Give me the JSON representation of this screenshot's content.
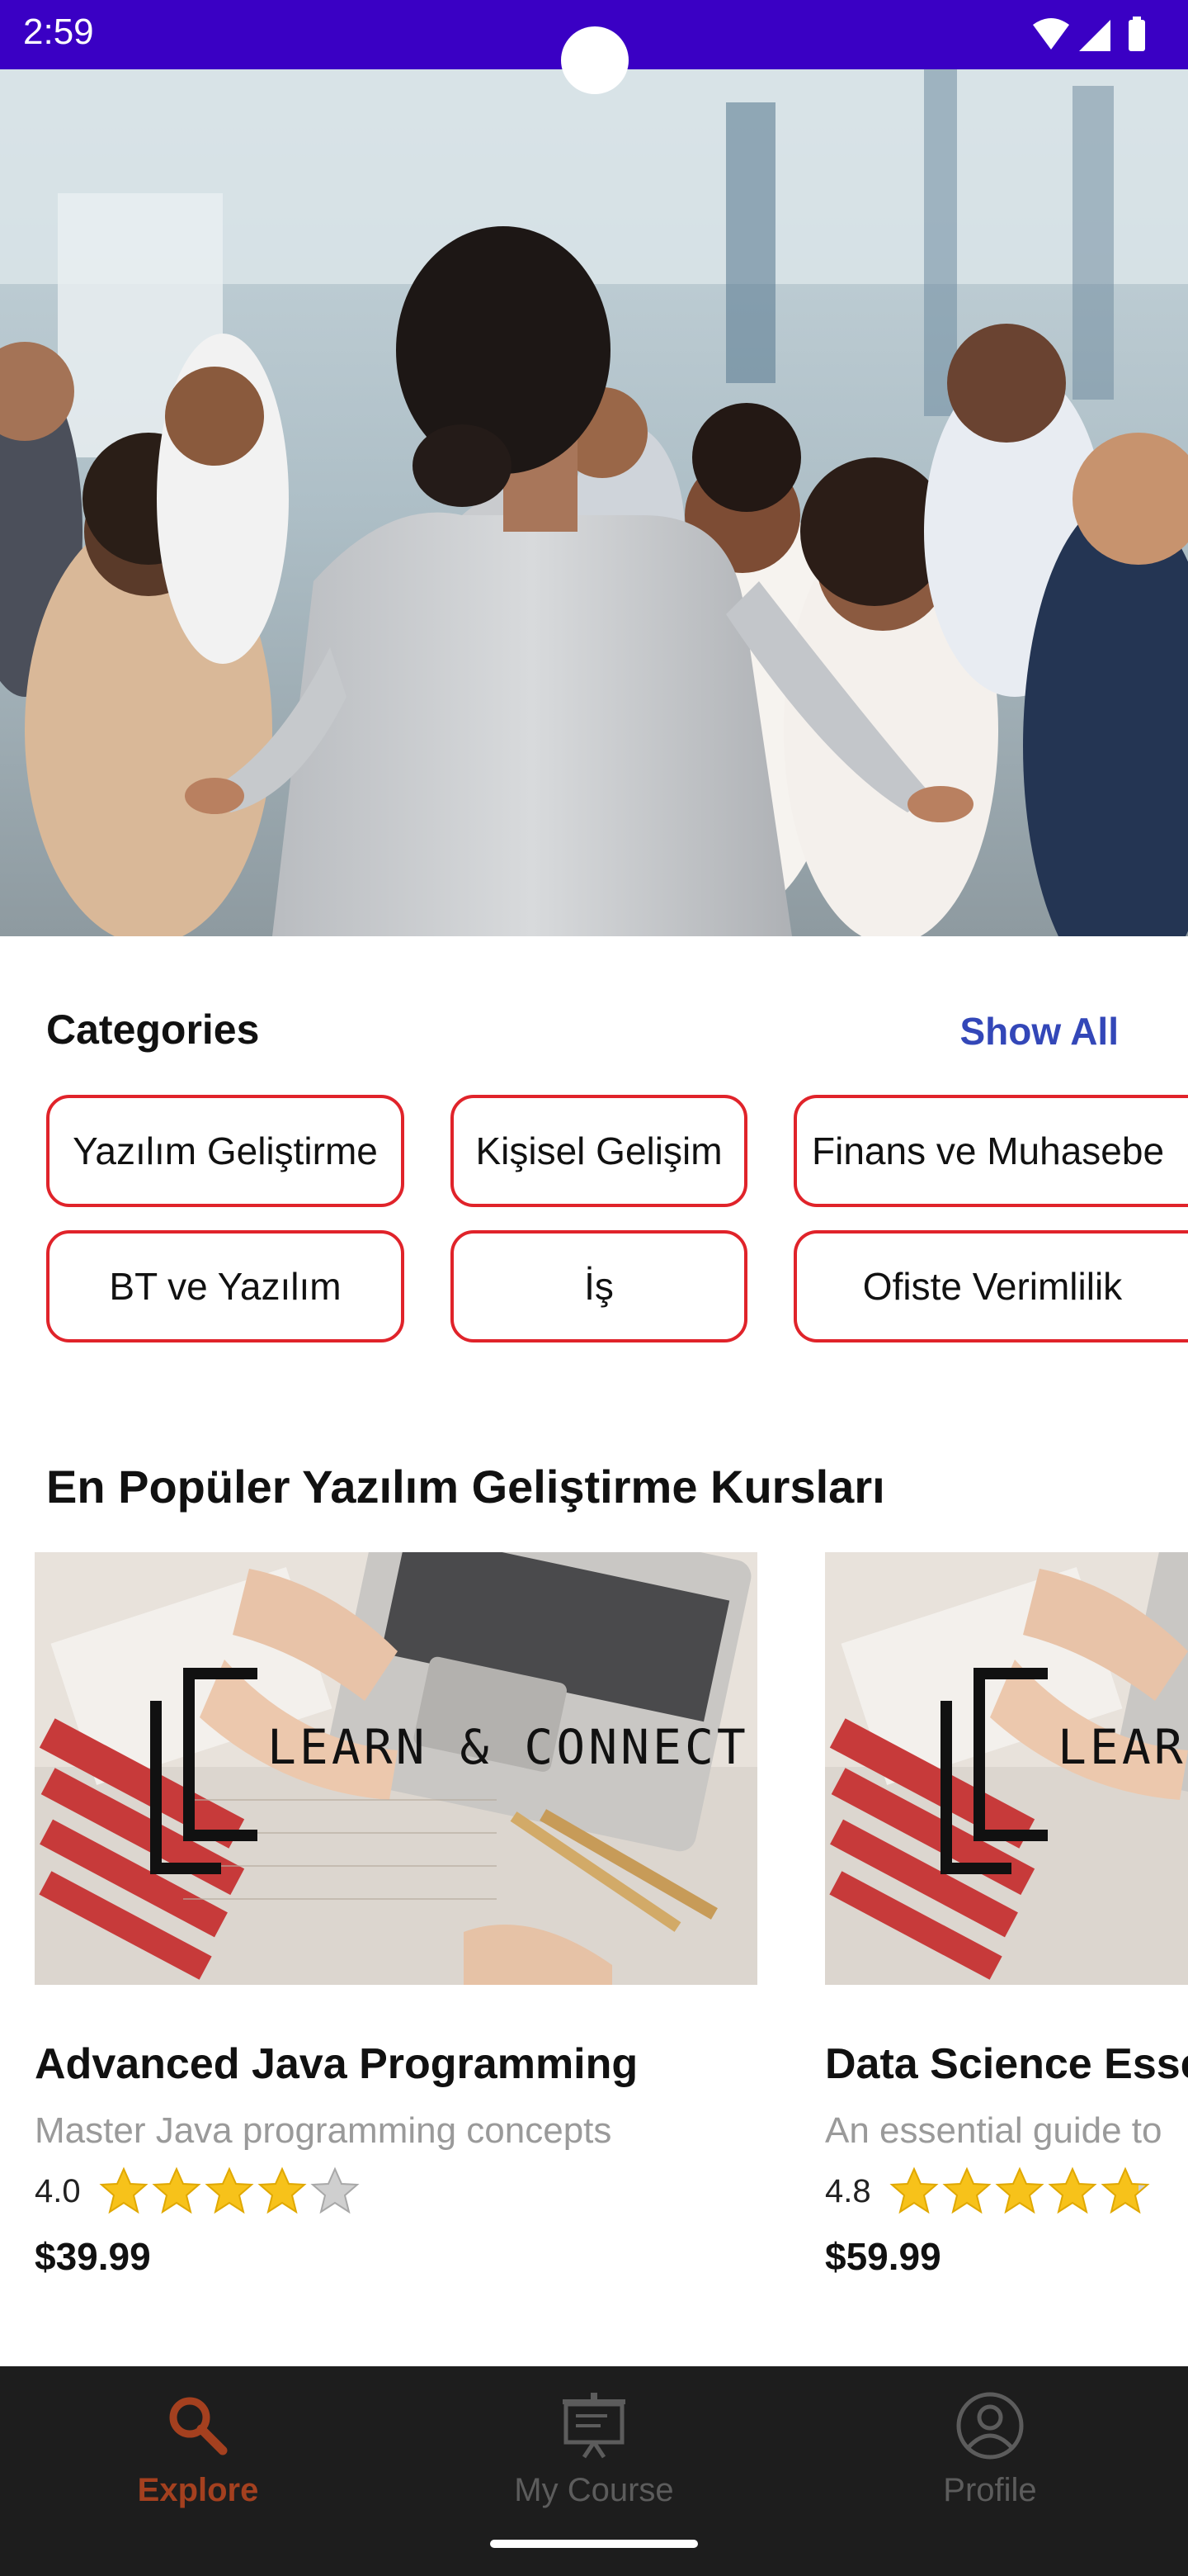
{
  "status_bar": {
    "time": "2:59"
  },
  "categories": {
    "title": "Categories",
    "show_all": "Show All",
    "chips": [
      "Yazılım Geliştirme",
      "Kişisel Gelişim",
      "Finans ve Muhasebe",
      "BT ve Yazılım",
      "İş",
      "Ofiste Verimlilik"
    ]
  },
  "popular": {
    "title": "En Popüler Yazılım Geliştirme Kursları",
    "logo_text": "LEARN & CONNECT",
    "courses": [
      {
        "title": "Advanced Java Programming",
        "subtitle": "Master Java programming concepts",
        "rating": "4.0",
        "price": "$39.99"
      },
      {
        "title": "Data Science Esse",
        "subtitle": "An essential guide to",
        "rating": "4.8",
        "price": "$59.99"
      }
    ]
  },
  "bottom_nav": {
    "items": [
      {
        "label": "Explore",
        "icon": "search-icon",
        "active": true
      },
      {
        "label": "My Course",
        "icon": "presentation-icon",
        "active": false
      },
      {
        "label": "Profile",
        "icon": "profile-icon",
        "active": false
      }
    ]
  },
  "colors": {
    "status_bar": "#3a00c4",
    "accent_link": "#3347b8",
    "chip_border": "#e0232a",
    "star": "#f7c21a",
    "nav_active": "#a4401f",
    "nav_inactive": "#5c5c5c",
    "nav_background": "#1d1d1d"
  }
}
